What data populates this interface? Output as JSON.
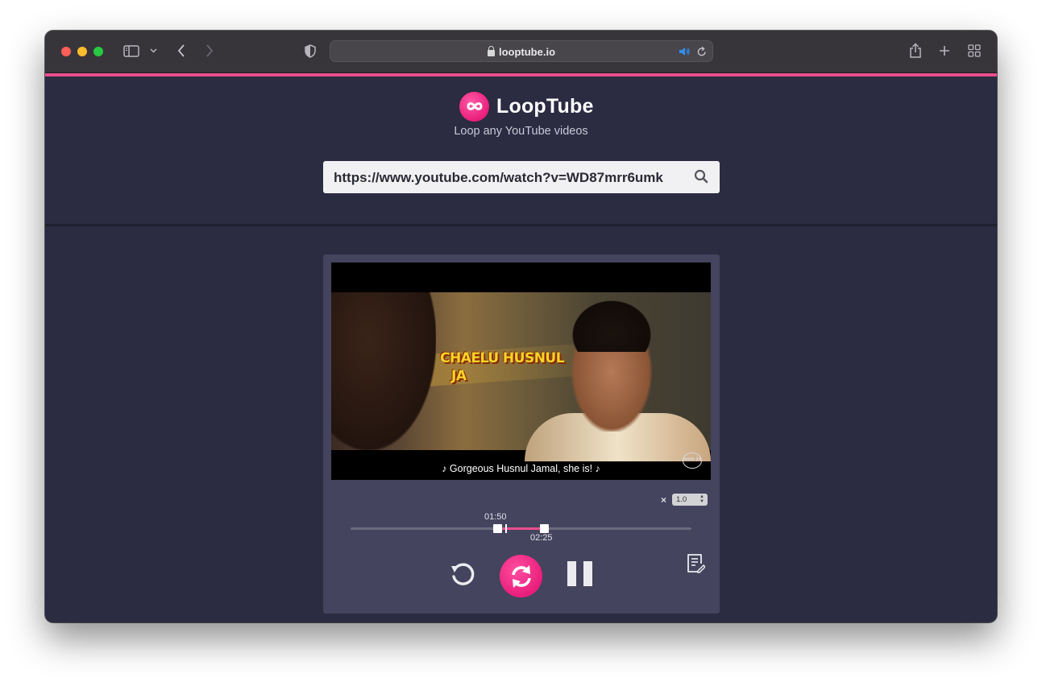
{
  "browser": {
    "url_display": "looptube.io",
    "audio_icon": "speaker-icon",
    "reload_icon": "reload-icon"
  },
  "app": {
    "brand": "LoopTube",
    "tagline": "Loop any YouTube videos",
    "search": {
      "value": "https://www.youtube.com/watch?v=WD87mrr6umk"
    }
  },
  "player": {
    "video_overlay_title_line1": "CHAELU HUSNUL",
    "video_overlay_title_line2": "JA",
    "subtitle": "♪ Gorgeous Husnul Jamal, she is! ♪",
    "watermark": "mzm 24",
    "speed_prefix": "×",
    "speed_value": "1.0",
    "loop_start": "01:50",
    "loop_end": "02:25",
    "loop_start_fraction": 0.43,
    "loop_end_fraction": 0.567,
    "playhead_fraction": 0.457
  },
  "colors": {
    "accent": "#ec4e8e",
    "background": "#2b2b42",
    "card": "#44445e"
  }
}
